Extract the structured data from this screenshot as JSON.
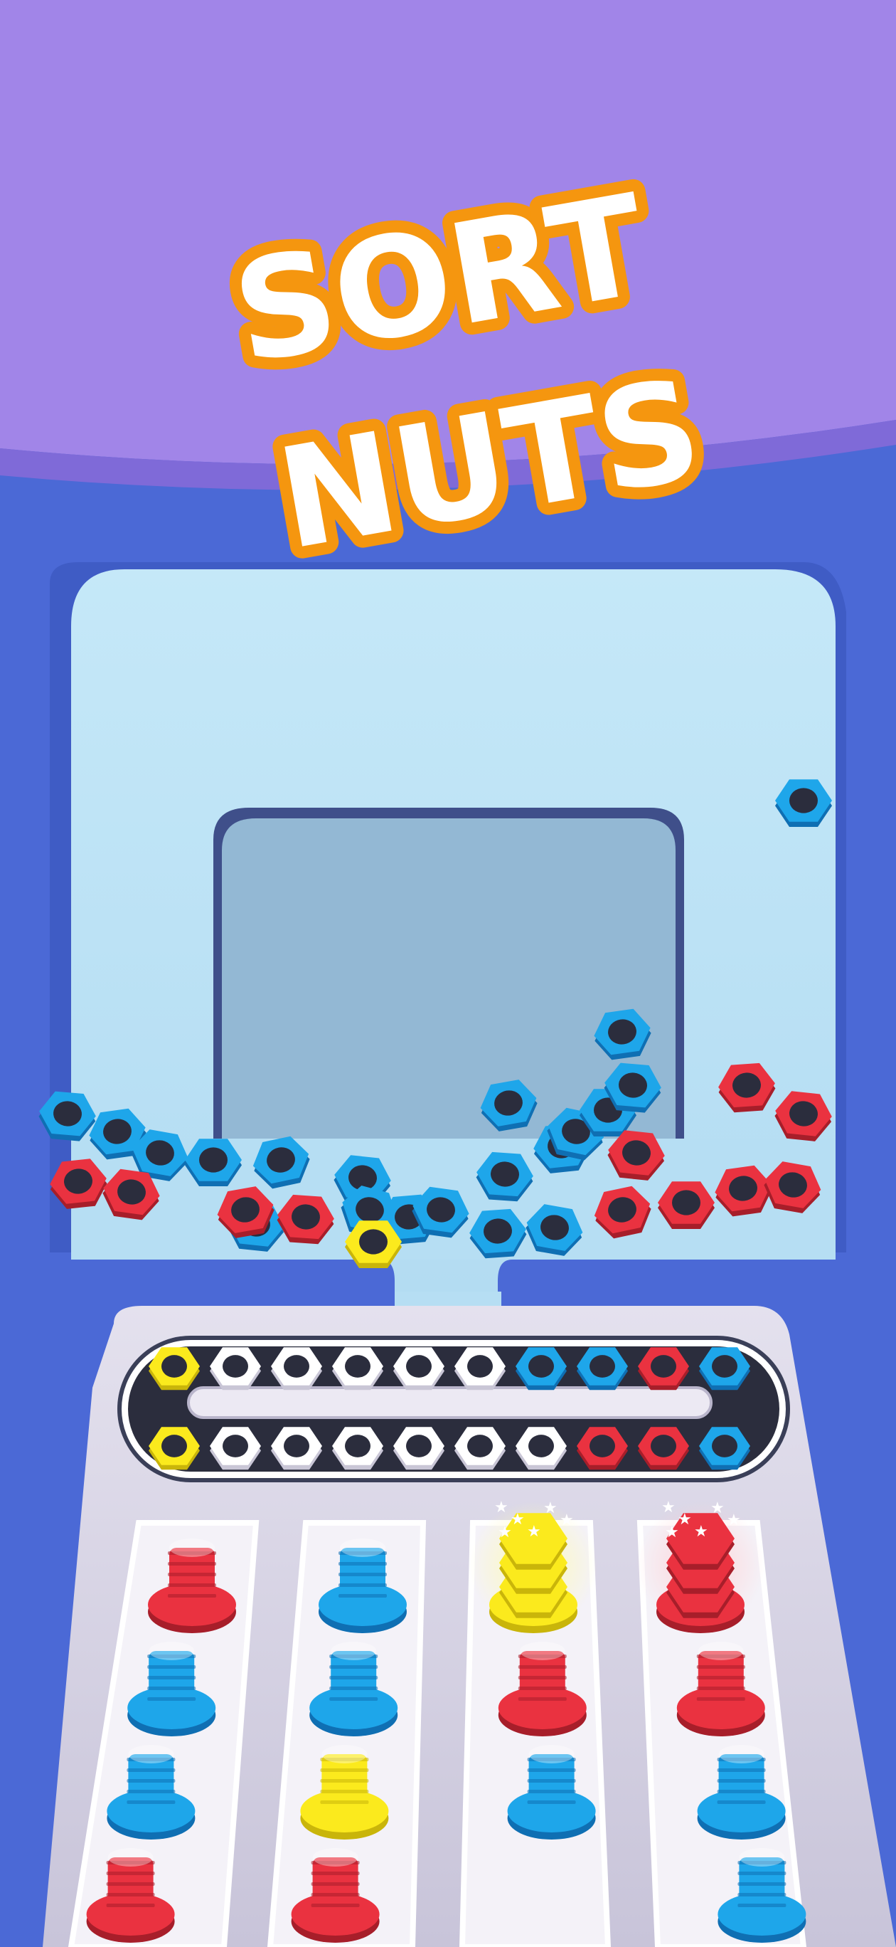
{
  "banner": {
    "title_line_1": "SORT",
    "title_line_2": "NUTS"
  },
  "colors": {
    "banner_purple": "#a185e8",
    "background_blue": "#4b69d6",
    "tank_light": "#bce3f6",
    "tank_inner": "#92b7d3",
    "nut_blue": "#1ea6ea",
    "nut_red": "#ea3240",
    "nut_yellow": "#fbea1d",
    "nut_white": "#ffffff",
    "title_outline": "#f5960f"
  },
  "tank": {
    "loose_nuts": [
      {
        "color": "blue"
      },
      {
        "color": "blue"
      },
      {
        "color": "blue"
      },
      {
        "color": "blue"
      },
      {
        "color": "blue"
      },
      {
        "color": "blue"
      },
      {
        "color": "blue"
      },
      {
        "color": "blue"
      },
      {
        "color": "blue"
      },
      {
        "color": "blue"
      },
      {
        "color": "blue"
      },
      {
        "color": "blue"
      },
      {
        "color": "blue"
      },
      {
        "color": "blue"
      },
      {
        "color": "blue"
      },
      {
        "color": "blue"
      },
      {
        "color": "blue"
      },
      {
        "color": "blue"
      },
      {
        "color": "blue"
      },
      {
        "color": "blue"
      },
      {
        "color": "red"
      },
      {
        "color": "red"
      },
      {
        "color": "red"
      },
      {
        "color": "red"
      },
      {
        "color": "red"
      },
      {
        "color": "red"
      },
      {
        "color": "red"
      },
      {
        "color": "red"
      },
      {
        "color": "red"
      },
      {
        "color": "red"
      },
      {
        "color": "red"
      },
      {
        "color": "yellow"
      }
    ]
  },
  "conveyor": {
    "top_row": [
      "yellow",
      "white",
      "white",
      "white",
      "white",
      "white",
      "blue",
      "blue",
      "red",
      "blue"
    ],
    "bottom_row": [
      "yellow",
      "white",
      "white",
      "white",
      "white",
      "white",
      "white",
      "red",
      "red",
      "blue"
    ]
  },
  "bolt_columns": [
    {
      "bolts": [
        {
          "color": "red"
        },
        {
          "color": "blue"
        },
        {
          "color": "blue"
        },
        {
          "color": "red"
        }
      ]
    },
    {
      "bolts": [
        {
          "color": "blue"
        },
        {
          "color": "blue"
        },
        {
          "color": "yellow"
        },
        {
          "color": "red"
        }
      ]
    },
    {
      "bolts": [
        {
          "color": "yellow",
          "stacked": true
        },
        {
          "color": "red"
        },
        {
          "color": "blue"
        }
      ]
    },
    {
      "bolts": [
        {
          "color": "red",
          "stacked": true
        },
        {
          "color": "red"
        },
        {
          "color": "blue"
        },
        {
          "color": "blue"
        }
      ]
    }
  ]
}
